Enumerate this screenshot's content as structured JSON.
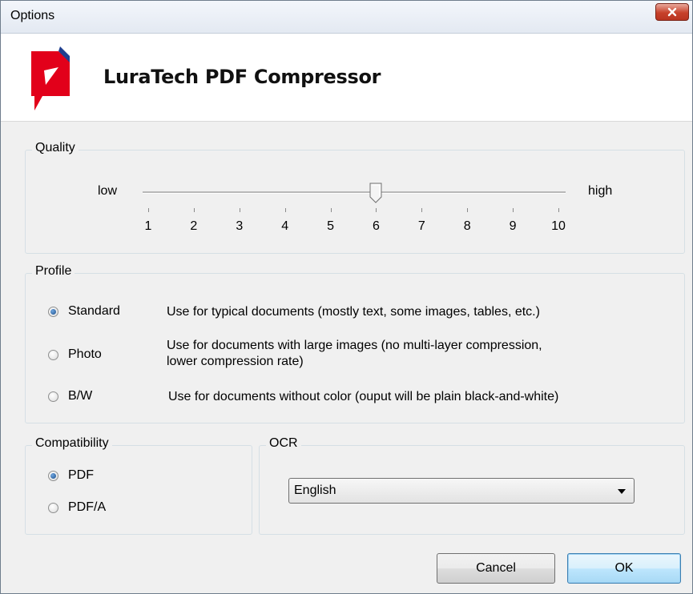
{
  "window": {
    "title": "Options"
  },
  "header": {
    "app_name": "LuraTech PDF Compressor"
  },
  "quality": {
    "legend": "Quality",
    "low_label": "low",
    "high_label": "high",
    "ticks": [
      "1",
      "2",
      "3",
      "4",
      "5",
      "6",
      "7",
      "8",
      "9",
      "10"
    ],
    "value": 6
  },
  "profile": {
    "legend": "Profile",
    "options": [
      {
        "label": "Standard",
        "description": "Use for typical documents (mostly text, some images, tables, etc.)",
        "selected": true
      },
      {
        "label": "Photo",
        "description_line1": "Use for documents with large images (no multi-layer compression,",
        "description_line2": "lower compression rate)",
        "selected": false
      },
      {
        "label": "B/W",
        "description": "Use for documents without color (ouput will be plain black-and-white)",
        "selected": false
      }
    ]
  },
  "compatibility": {
    "legend": "Compatibility",
    "options": [
      {
        "label": "PDF",
        "selected": true
      },
      {
        "label": "PDF/A",
        "selected": false
      }
    ]
  },
  "ocr": {
    "legend": "OCR",
    "selected_language": "English"
  },
  "buttons": {
    "cancel": "Cancel",
    "ok": "OK"
  },
  "colors": {
    "brand_red": "#e2001a",
    "brand_blue": "#1f3f8f",
    "close_red": "#c7412b"
  },
  "icons": {
    "close": "close-icon",
    "logo": "luratech-logo-icon",
    "dropdown": "chevron-down-icon"
  }
}
